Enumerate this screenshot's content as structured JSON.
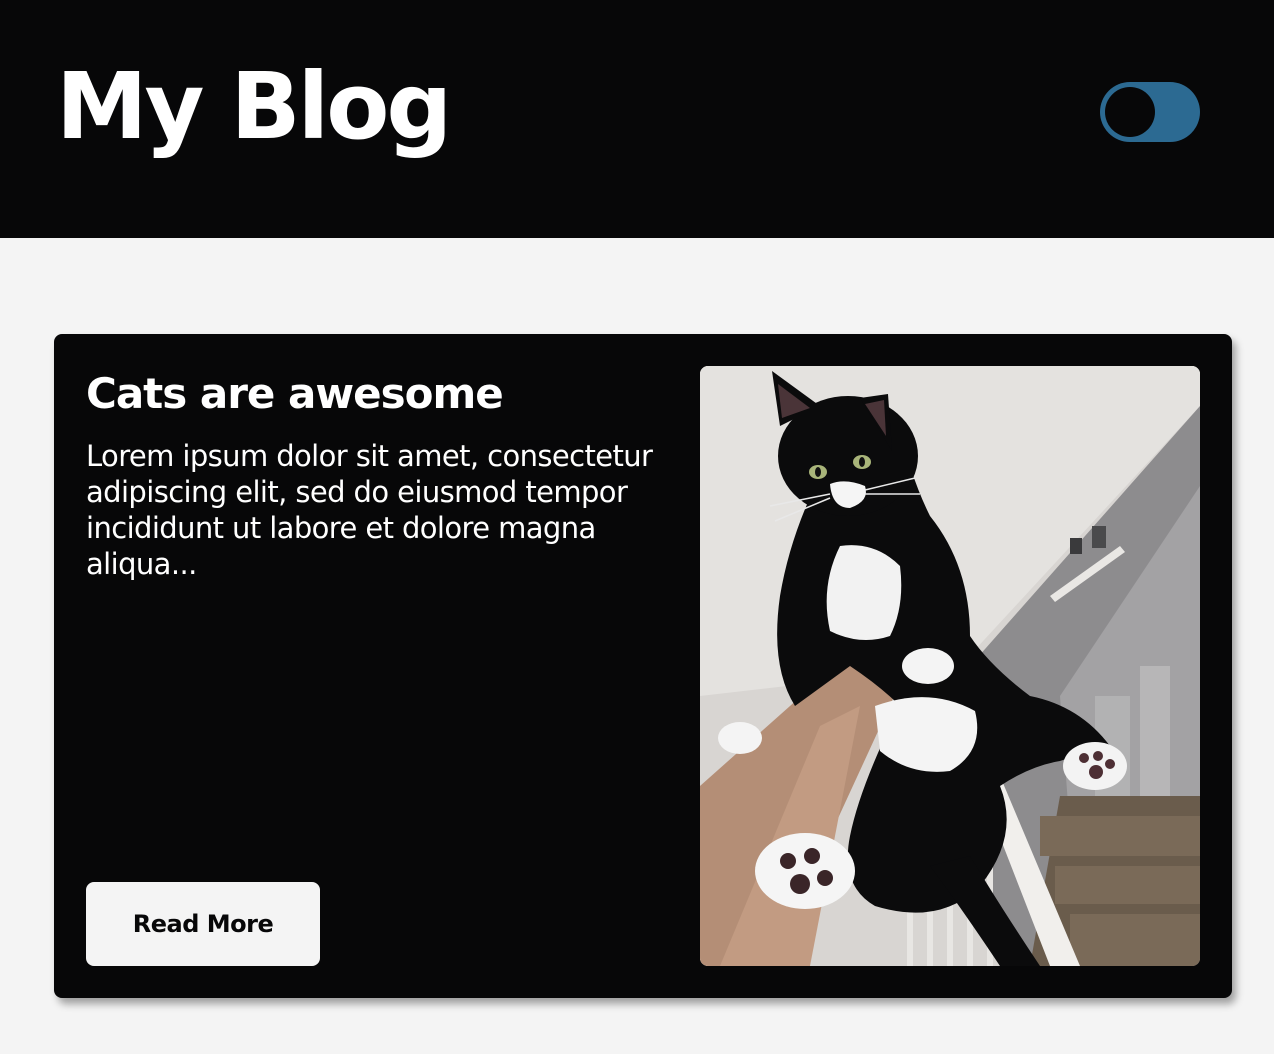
{
  "header": {
    "title": "My Blog",
    "background": "#070708",
    "toggle": {
      "icon": "theme-toggle-switch",
      "color": "#2c6a92",
      "state": "dark"
    }
  },
  "post": {
    "title": "Cats are awesome",
    "excerpt": "Lorem ipsum dolor sit amet, consectetur adipiscing elit, sed do eiusmod tempor incididunt ut labore et dolore magna aliqua...",
    "read_more_label": "Read More",
    "image": {
      "subject": "black-and-white-cat-held-up"
    }
  },
  "colors": {
    "page_background": "#f4f4f4",
    "card_background": "#070708",
    "text": "#ffffff",
    "accent": "#2c6a92"
  }
}
